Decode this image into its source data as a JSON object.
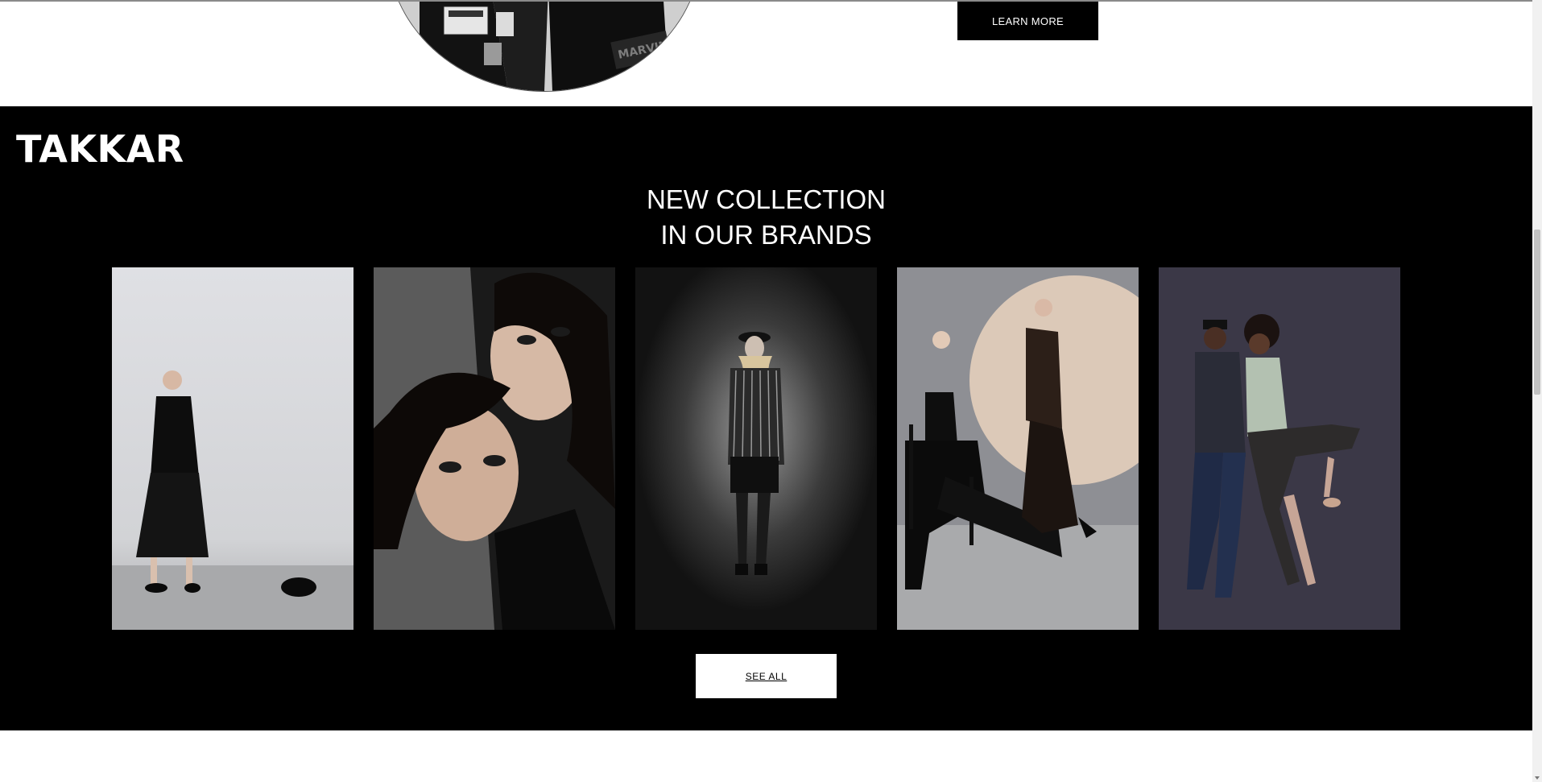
{
  "hero": {
    "learn_more_label": "LEARN MORE",
    "jacket_patch_text": "MARVINSL"
  },
  "collection": {
    "brand": "TAKKAR",
    "headline_line1": "NEW COLLECTION",
    "headline_line2": "IN OUR BRANDS",
    "see_all_label": "SEE ALL",
    "images": [
      {
        "name": "model-black-skirt-photo"
      },
      {
        "name": "two-women-smoky-eyes-photo"
      },
      {
        "name": "woman-striped-shirt-hat-photo"
      },
      {
        "name": "two-women-chair-photo"
      },
      {
        "name": "couple-posing-photo"
      }
    ]
  },
  "colors": {
    "section_bg": "#000000",
    "button_dark": "#000000",
    "button_light": "#ffffff"
  }
}
